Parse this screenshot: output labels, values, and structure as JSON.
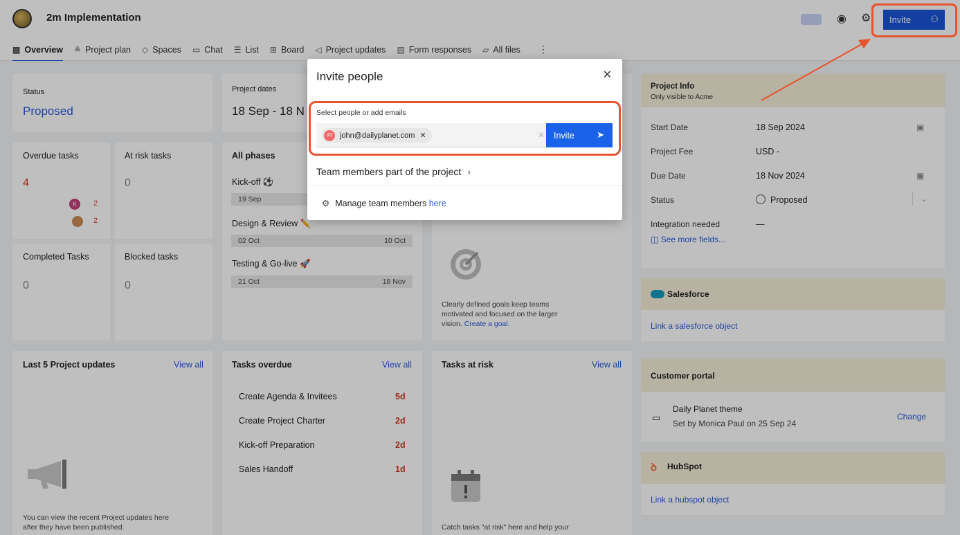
{
  "header": {
    "project_title": "2m Implementation",
    "invite_label": "Invite"
  },
  "tabs": [
    {
      "label": "Overview",
      "icon": "overview-icon"
    },
    {
      "label": "Project plan",
      "icon": "project-plan-icon"
    },
    {
      "label": "Spaces",
      "icon": "spaces-icon"
    },
    {
      "label": "Chat",
      "icon": "chat-icon"
    },
    {
      "label": "List",
      "icon": "list-icon"
    },
    {
      "label": "Board",
      "icon": "board-icon"
    },
    {
      "label": "Project updates",
      "icon": "megaphone-icon"
    },
    {
      "label": "Form responses",
      "icon": "form-icon"
    },
    {
      "label": "All files",
      "icon": "folder-icon"
    }
  ],
  "status_card": {
    "label": "Status",
    "value": "Proposed"
  },
  "dates_card": {
    "label": "Project dates",
    "value": "18 Sep - 18 N"
  },
  "overdue": {
    "label": "Overdue tasks",
    "value": "4",
    "user1_count": "2",
    "user2_count": "2",
    "user1_initial": "K"
  },
  "at_risk": {
    "label": "At risk tasks",
    "value": "0"
  },
  "completed": {
    "label": "Completed Tasks",
    "value": "0"
  },
  "blocked": {
    "label": "Blocked tasks",
    "value": "0"
  },
  "phases": {
    "title": "All phases",
    "items": [
      {
        "name": "Kick-off ⚽",
        "start": "19 Sep",
        "end": ""
      },
      {
        "name": "Design & Review ✏️",
        "start": "02 Oct",
        "end": "10 Oct"
      },
      {
        "name": "Testing & Go-live 🚀",
        "start": "21 Oct",
        "end": "18 Nov"
      }
    ]
  },
  "goals": {
    "text": "Clearly defined goals keep teams motivated and focused on the larger vision.",
    "link": "Create a goal."
  },
  "updates": {
    "title": "Last 5 Project updates",
    "view_all": "View all",
    "empty_text": "You can view the recent Project updates here after they have been published."
  },
  "tasks_overdue": {
    "title": "Tasks overdue",
    "view_all": "View all",
    "rows": [
      {
        "name": "Create Agenda & Invitees",
        "days": "5d"
      },
      {
        "name": "Create Project Charter",
        "days": "2d"
      },
      {
        "name": "Kick-off Preparation",
        "days": "2d"
      },
      {
        "name": "Sales Handoff",
        "days": "1d"
      }
    ]
  },
  "tasks_at_risk": {
    "title": "Tasks at risk",
    "view_all": "View all",
    "empty_text": "Catch tasks \"at risk\" here and help your"
  },
  "project_info": {
    "title": "Project Info",
    "subtitle": "Only visible to Acme",
    "rows": [
      {
        "label": "Start Date",
        "value": "18 Sep 2024"
      },
      {
        "label": "Project Fee",
        "value": "USD -"
      },
      {
        "label": "Due Date",
        "value": "18 Nov 2024"
      },
      {
        "label": "Status",
        "value": "Proposed"
      },
      {
        "label": "Integration needed",
        "value": "—"
      }
    ],
    "see_more": "See more fields..."
  },
  "salesforce": {
    "title": "Salesforce",
    "link": "Link a salesforce object"
  },
  "portal": {
    "title": "Customer portal",
    "theme": "Daily Planet theme",
    "set_by": "Set by Monica Paul on 25 Sep 24",
    "change": "Change"
  },
  "hubspot": {
    "title": "HubSpot",
    "link": "Link a hubspot object"
  },
  "modal": {
    "title": "Invite people",
    "select_label": "Select people or add emails",
    "chip_initials": "JO",
    "chip_email": "john@dailyplanet.com",
    "invite_label": "Invite",
    "team_members": "Team members part of the project",
    "manage_text": "Manage team members ",
    "manage_link": "here"
  },
  "colors": {
    "accent": "#1a55d9",
    "danger": "#d23a2a",
    "highlight": "#e8542e"
  }
}
